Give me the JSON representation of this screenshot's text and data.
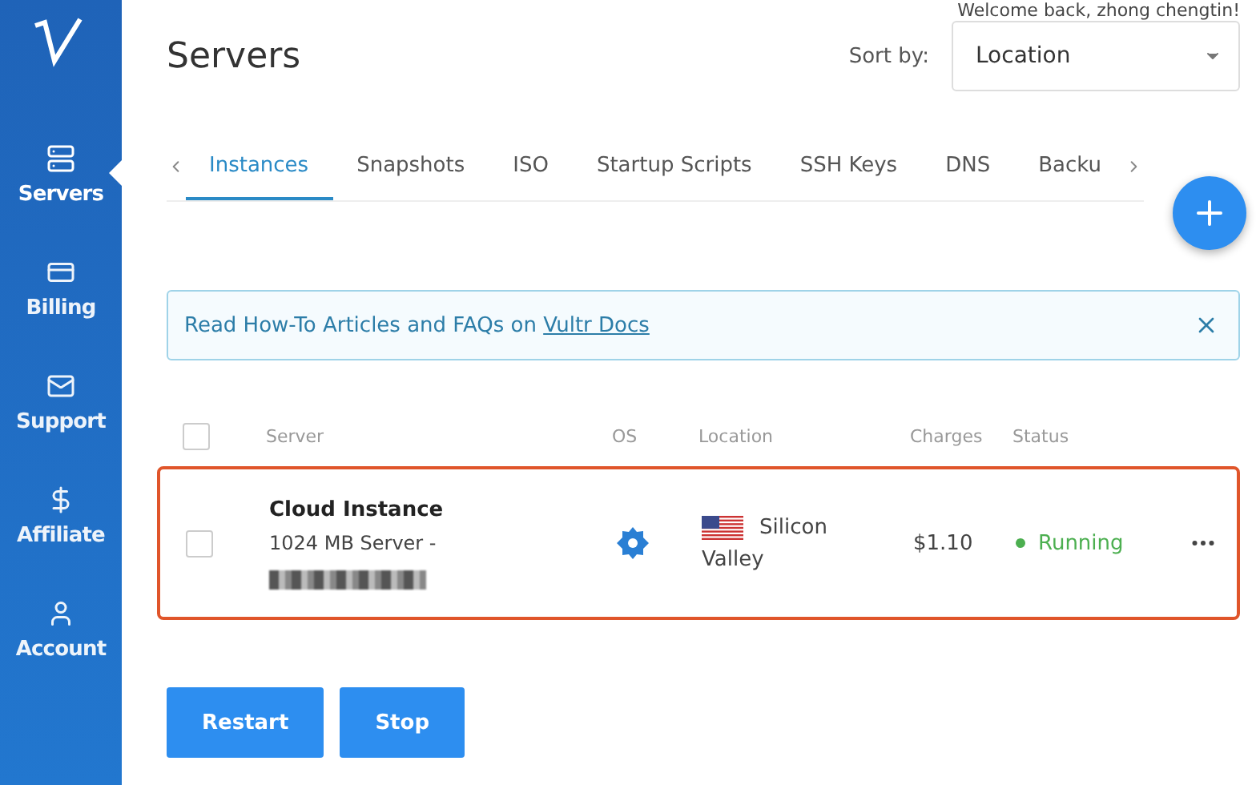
{
  "header": {
    "welcome": "Welcome back, zhong chengtin!",
    "title": "Servers",
    "sort_label": "Sort by:",
    "sort_value": "Location"
  },
  "sidebar": {
    "items": [
      {
        "label": "Servers",
        "kind": "servers",
        "selected": true
      },
      {
        "label": "Billing",
        "kind": "billing",
        "selected": false
      },
      {
        "label": "Support",
        "kind": "support",
        "selected": false
      },
      {
        "label": "Affiliate",
        "kind": "affiliate",
        "selected": false
      },
      {
        "label": "Account",
        "kind": "account",
        "selected": false
      }
    ]
  },
  "tabs": [
    {
      "label": "Instances",
      "selected": true
    },
    {
      "label": "Snapshots",
      "selected": false
    },
    {
      "label": "ISO",
      "selected": false
    },
    {
      "label": "Startup Scripts",
      "selected": false
    },
    {
      "label": "SSH Keys",
      "selected": false
    },
    {
      "label": "DNS",
      "selected": false
    },
    {
      "label": "Backu",
      "selected": false
    }
  ],
  "banner": {
    "text": "Read How-To Articles and FAQs on ",
    "link": "Vultr Docs"
  },
  "table": {
    "select_all_checked": false,
    "columns": [
      "Server",
      "OS",
      "Location",
      "Charges",
      "Status"
    ],
    "rows": [
      {
        "name": "Cloud Instance",
        "plan": "1024 MB Server -",
        "checked": false,
        "highlighted": true,
        "location_line1": "Silicon",
        "location_line2": "Valley",
        "charges": "$1.10",
        "status": "Running",
        "color": "#4caf50"
      }
    ]
  },
  "buttons": [
    "Restart",
    "Stop"
  ]
}
